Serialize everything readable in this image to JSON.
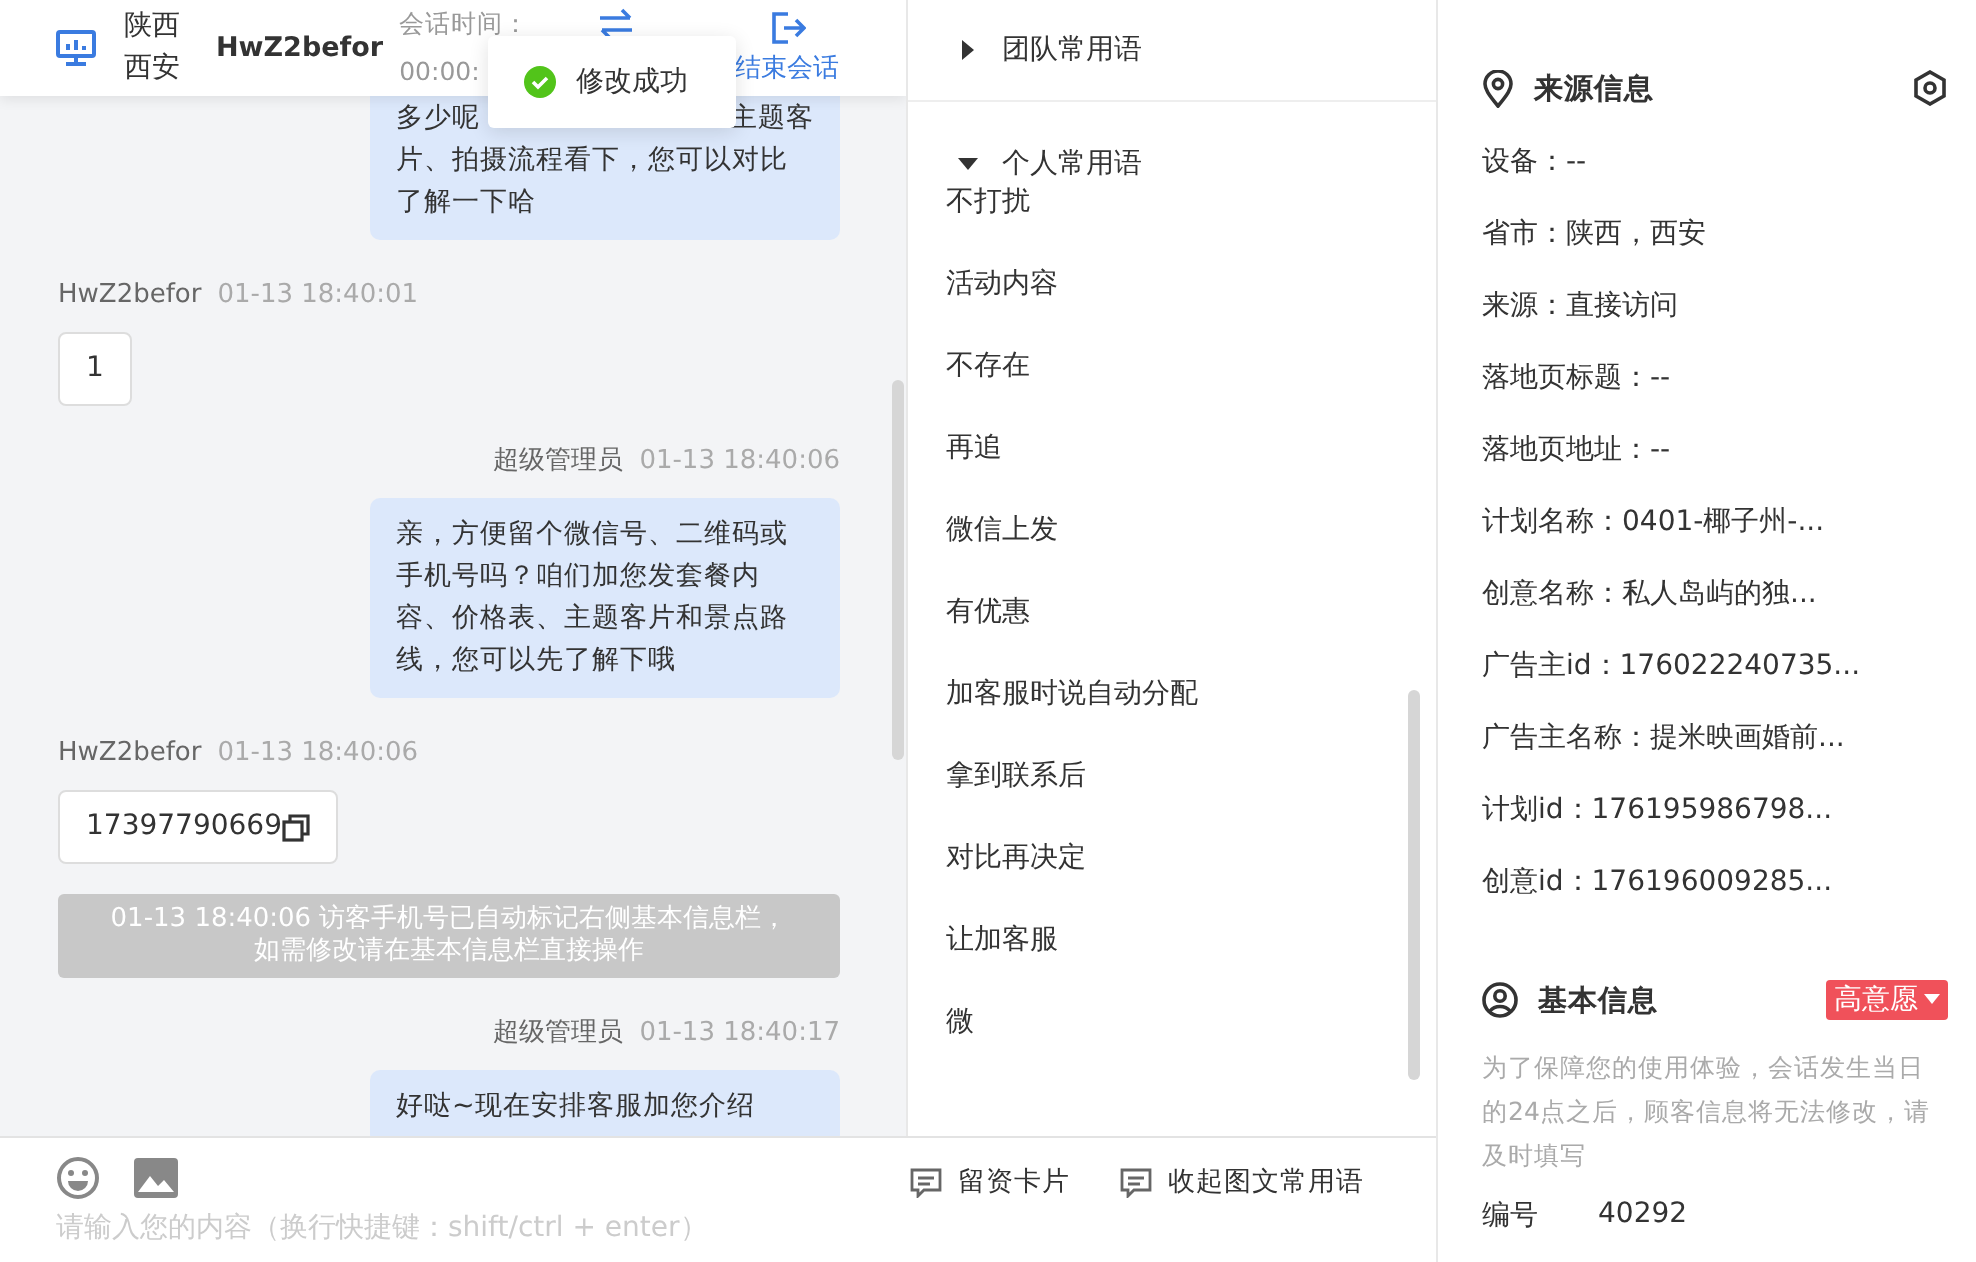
{
  "header": {
    "location": [
      "陕西",
      "西安"
    ],
    "visitor": "HwZ2befor",
    "session_label": "会话时间：",
    "session_time": "00:00:",
    "end_button": "结束会话"
  },
  "toast": {
    "kind": "success",
    "text": "修改成功"
  },
  "messages": [
    {
      "kind": "agent",
      "partial_first_line": [
        "多少呢",
        "主题客"
      ],
      "text": "片、拍摄流程看下，您可以对比了解一下哈"
    },
    {
      "kind": "visitor",
      "sender": "HwZ2befor",
      "time": "01-13 18:40:01",
      "text": "1"
    },
    {
      "kind": "agent",
      "sender": "超级管理员",
      "time": "01-13 18:40:06",
      "text": "亲，方便留个微信号、二维码或手机号吗？咱们加您发套餐内容、价格表、主题客片和景点路线，您可以先了解下哦"
    },
    {
      "kind": "visitor",
      "sender": "HwZ2befor",
      "time": "01-13 18:40:06",
      "text": "17397790669",
      "copyable": true
    },
    {
      "kind": "system",
      "text": "01-13 18:40:06 访客手机号已自动标记右侧基本信息栏，如需修改请在基本信息栏直接操作"
    },
    {
      "kind": "agent",
      "sender": "超级管理员",
      "time": "01-13 18:40:17",
      "text": "好哒~现在安排客服加您介绍"
    }
  ],
  "composer": {
    "placeholder": "请输入您的内容（换行快捷键：shift/ctrl + enter）"
  },
  "phrase_groups": [
    {
      "title": "团队常用语",
      "expanded": false
    },
    {
      "title": "个人常用语",
      "expanded": true,
      "items": [
        "不打扰",
        "活动内容",
        "不存在",
        "再追",
        "微信上发",
        "有优惠",
        "加客服时说自动分配",
        "拿到联系后",
        "对比再决定",
        "让加客服",
        "微"
      ]
    }
  ],
  "phrase_buttons": [
    "留资卡片",
    "收起图文常用语"
  ],
  "source_info": {
    "title": "来源信息",
    "rows": [
      "设备：--",
      "省市：陕西，西安",
      "来源：直接访问",
      "落地页标题：--",
      "落地页地址：--",
      "计划名称：0401-椰子州-...",
      "创意名称：私人岛屿的独...",
      "广告主id：176022240735...",
      "广告主名称：提米映画婚前...",
      "计划id：176195986798...",
      "创意id：176196009285..."
    ]
  },
  "basic_info": {
    "title": "基本信息",
    "intent": "高意愿",
    "note": "为了保障您的使用体验，会话发生当日的24点之后，顾客信息将无法修改，请及时填写",
    "fields": [
      {
        "label": "编号",
        "value": "40292"
      }
    ]
  }
}
